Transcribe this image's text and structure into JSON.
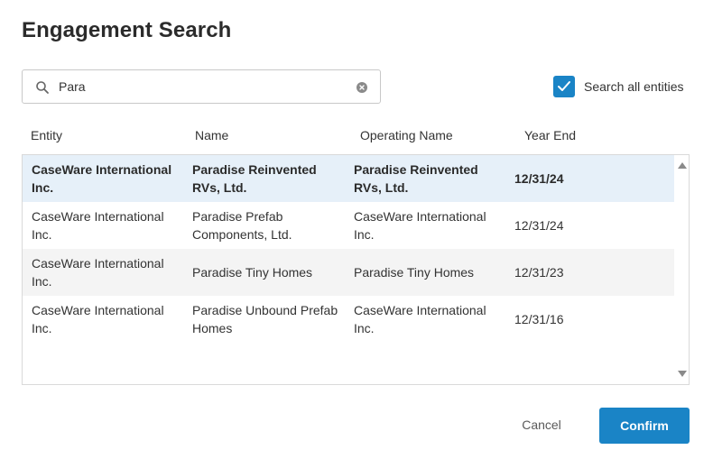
{
  "dialog": {
    "title": "Engagement Search"
  },
  "search": {
    "value": "Para",
    "placeholder": ""
  },
  "search_all": {
    "label": "Search all entities",
    "checked": true
  },
  "columns": {
    "entity": "Entity",
    "name": "Name",
    "operating_name": "Operating Name",
    "year_end": "Year End"
  },
  "rows": [
    {
      "entity": "CaseWare International Inc.",
      "name": "Paradise Reinvented RVs, Ltd.",
      "operating_name": "Paradise Reinvented RVs, Ltd.",
      "year_end": "12/31/24",
      "selected": true
    },
    {
      "entity": "CaseWare International Inc.",
      "name": "Paradise Prefab Components, Ltd.",
      "operating_name": "CaseWare International Inc.",
      "year_end": "12/31/24",
      "selected": false
    },
    {
      "entity": "CaseWare International Inc.",
      "name": "Paradise Tiny Homes",
      "operating_name": "Paradise Tiny Homes",
      "year_end": "12/31/23",
      "selected": false
    },
    {
      "entity": "CaseWare International Inc.",
      "name": "Paradise Unbound Prefab Homes",
      "operating_name": "CaseWare International Inc.",
      "year_end": "12/31/16",
      "selected": false
    }
  ],
  "buttons": {
    "cancel": "Cancel",
    "confirm": "Confirm"
  },
  "colors": {
    "accent": "#1a84c6",
    "selected_row": "#e6f0f9",
    "alt_row": "#f4f4f4"
  },
  "icons": {
    "search": "search-icon",
    "clear": "clear-icon",
    "check": "check-icon"
  }
}
